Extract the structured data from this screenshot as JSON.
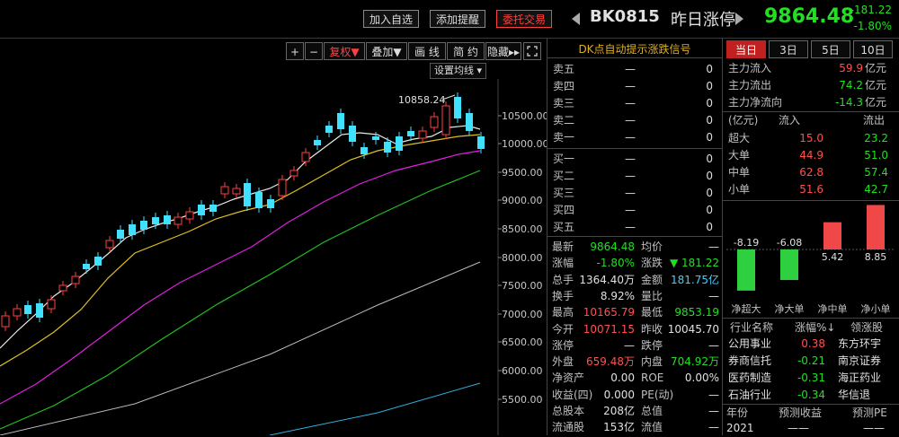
{
  "header": {
    "buttons": [
      "加入自选",
      "添加提醒",
      "委托交易"
    ],
    "code": "BK0815",
    "name": "昨日涨停",
    "price": "9864.48",
    "change": "-181.22",
    "pct": "-1.80%"
  },
  "toolbar": {
    "buttons": [
      "+",
      "−",
      "复权▼",
      "叠加▼",
      "画 线",
      "简 约",
      "隐藏▸▸"
    ],
    "ma_setting": "设置均线 ▾",
    "high_label": "10858.24"
  },
  "chart_axis": {
    "ticks": [
      "10500.00",
      "10000.00",
      "9500.00",
      "9000.00",
      "8500.00",
      "8000.00",
      "7500.00",
      "7000.00",
      "6500.00",
      "6000.00",
      "5500.00"
    ]
  },
  "orderbook": {
    "title": "DK点自动提示涨跌信号",
    "sell": [
      {
        "label": "卖五",
        "dash": "—",
        "val": "0"
      },
      {
        "label": "卖四",
        "dash": "—",
        "val": "0"
      },
      {
        "label": "卖三",
        "dash": "—",
        "val": "0"
      },
      {
        "label": "卖二",
        "dash": "—",
        "val": "0"
      },
      {
        "label": "卖一",
        "dash": "—",
        "val": "0"
      }
    ],
    "buy": [
      {
        "label": "买一",
        "dash": "—",
        "val": "0"
      },
      {
        "label": "买二",
        "dash": "—",
        "val": "0"
      },
      {
        "label": "买三",
        "dash": "—",
        "val": "0"
      },
      {
        "label": "买四",
        "dash": "—",
        "val": "0"
      },
      {
        "label": "买五",
        "dash": "—",
        "val": "0"
      }
    ]
  },
  "quote": [
    {
      "l1": "最新",
      "v1": "9864.48",
      "c1": "green",
      "l2": "均价",
      "v2": "—",
      "c2": "white"
    },
    {
      "l1": "涨幅",
      "v1": "-1.80%",
      "c1": "green",
      "l2": "涨跌",
      "v2": "▼ 181.22",
      "c2": "green"
    },
    {
      "l1": "总手",
      "v1": "1364.40万",
      "c1": "white",
      "l2": "金额",
      "v2": "181.75亿",
      "c2": "cyan"
    },
    {
      "l1": "换手",
      "v1": "8.92%",
      "c1": "white",
      "l2": "量比",
      "v2": "—",
      "c2": "white"
    },
    {
      "l1": "最高",
      "v1": "10165.79",
      "c1": "red",
      "l2": "最低",
      "v2": "9853.19",
      "c2": "green"
    },
    {
      "l1": "今开",
      "v1": "10071.15",
      "c1": "red",
      "l2": "昨收",
      "v2": "10045.70",
      "c2": "white"
    },
    {
      "l1": "涨停",
      "v1": "—",
      "c1": "white",
      "l2": "跌停",
      "v2": "—",
      "c2": "white"
    },
    {
      "l1": "外盘",
      "v1": "659.48万",
      "c1": "red",
      "l2": "内盘",
      "v2": "704.92万",
      "c2": "green"
    },
    {
      "l1": "净资产",
      "v1": "0.00",
      "c1": "white",
      "l2": "ROE",
      "v2": "0.00%",
      "c2": "white"
    },
    {
      "l1": "收益(四)",
      "v1": "0.000",
      "c1": "white",
      "l2": "PE(动)",
      "v2": "—",
      "c2": "white"
    },
    {
      "l1": "总股本",
      "v1": "208亿",
      "c1": "white",
      "l2": "总值",
      "v2": "—",
      "c2": "white"
    },
    {
      "l1": "流通股",
      "v1": "153亿",
      "c1": "white",
      "l2": "流值",
      "v2": "—",
      "c2": "white"
    }
  ],
  "capital": {
    "tabs": [
      "当日",
      "3日",
      "5日",
      "10日"
    ],
    "active_tab": "当日",
    "flows": [
      {
        "label": "主力流入",
        "value": "59.9",
        "unit": "亿元",
        "color": "red"
      },
      {
        "label": "主力流出",
        "value": "74.2",
        "unit": "亿元",
        "color": "green"
      },
      {
        "label": "主力净流向",
        "value": "-14.3",
        "unit": "亿元",
        "color": "green"
      }
    ],
    "table_header": {
      "unit": "(亿元)",
      "in": "流入",
      "out": "流出"
    },
    "table": [
      {
        "label": "超大",
        "in": "15.0",
        "out": "23.2"
      },
      {
        "label": "大单",
        "in": "44.9",
        "out": "51.0"
      },
      {
        "label": "中单",
        "in": "62.8",
        "out": "57.4"
      },
      {
        "label": "小单",
        "in": "51.6",
        "out": "42.7"
      }
    ],
    "bars": [
      {
        "label": "净超大",
        "value": -8.19,
        "text": "-8.19"
      },
      {
        "label": "净大单",
        "value": -6.08,
        "text": "-6.08"
      },
      {
        "label": "净中单",
        "value": 5.42,
        "text": "5.42"
      },
      {
        "label": "净小单",
        "value": 8.85,
        "text": "8.85"
      }
    ]
  },
  "industry": {
    "header": [
      "行业名称",
      "涨幅%↓",
      "领涨股"
    ],
    "rows": [
      {
        "name": "公用事业",
        "pct": "0.38",
        "color": "red",
        "leader": "东方环宇"
      },
      {
        "name": "券商信托",
        "pct": "-0.21",
        "color": "green",
        "leader": "南京证券"
      },
      {
        "name": "医药制造",
        "pct": "-0.31",
        "color": "green",
        "leader": "海正药业"
      },
      {
        "name": "石油行业",
        "pct": "-0.34",
        "color": "green",
        "leader": "华信退"
      }
    ]
  },
  "forecast": {
    "header": [
      "年份",
      "预测收益",
      "预测PE"
    ],
    "row": [
      "2021",
      "——",
      "——"
    ]
  }
}
